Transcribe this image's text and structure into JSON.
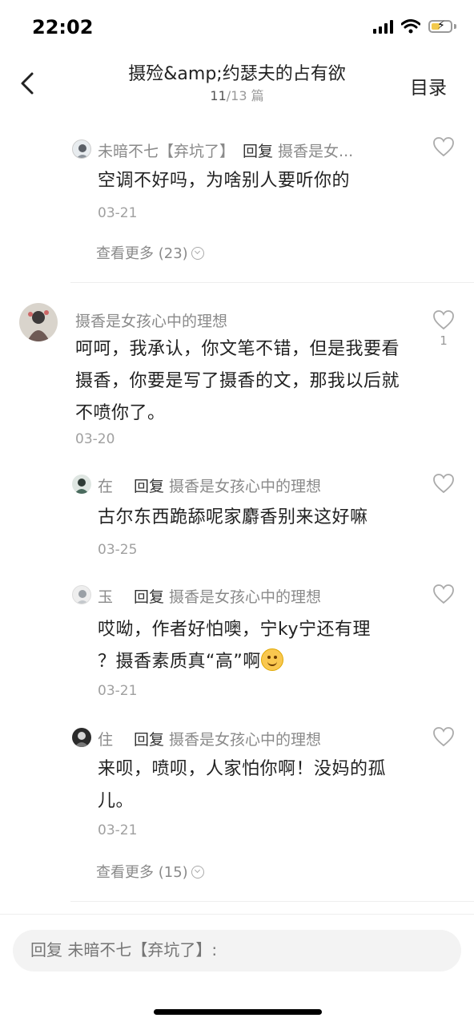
{
  "status": {
    "time": "22:02"
  },
  "nav": {
    "title": "摄殓&amp;约瑟夫的占有欲",
    "current": "11",
    "total_label": "/13 篇",
    "catalog": "目录"
  },
  "thread1": {
    "reply": {
      "name": "未暗不七【弃坑了】",
      "reply_word": "回复",
      "target": "摄香是女...",
      "text": "空调不好吗，为啥别人要听你的",
      "date": "03-21"
    },
    "more": "查看更多 (23)"
  },
  "thread2": {
    "main": {
      "name": "摄香是女孩心中的理想",
      "text": "呵呵，我承认，你文笔不错，但是我要看摄香，你要是写了摄香的文，那我以后就不喷你了。",
      "date": "03-20",
      "likes": "1"
    },
    "replies": [
      {
        "name": "在",
        "reply_word": "回复",
        "target": "摄香是女孩心中的理想",
        "text": "古尔东西跪舔呢家麝香别来这好嘛",
        "date": "03-25"
      },
      {
        "name": "玉",
        "reply_word": "回复",
        "target": "摄香是女孩心中的理想",
        "text_line1": "哎呦，作者好怕噢，宁ky宁还有理",
        "text_line2": "？摄香素质真“高”啊",
        "date": "03-21"
      },
      {
        "name": "住",
        "reply_word": "回复",
        "target": "摄香是女孩心中的理想",
        "text": "来呗，喷呗，人家怕你啊！没妈的孤儿。",
        "date": "03-21"
      }
    ],
    "more": "查看更多 (15)"
  },
  "reply_bar": {
    "placeholder": "回复 未暗不七【弃坑了】:"
  },
  "icons": [
    "back-icon",
    "heart-outline-icon",
    "smile-emoji-icon",
    "wifi-icon",
    "battery-icon",
    "signal-icon"
  ]
}
